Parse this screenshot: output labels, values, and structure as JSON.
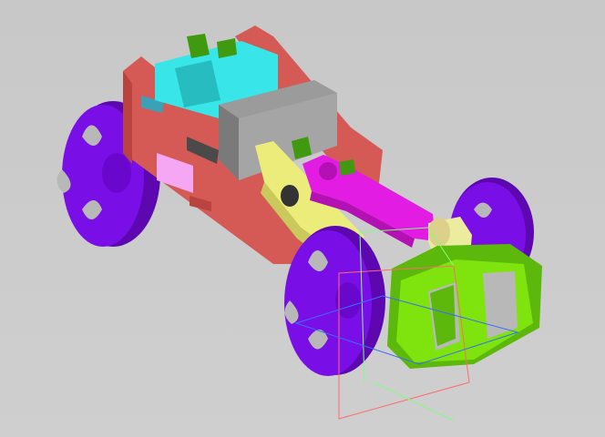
{
  "viewport": {
    "background": "#cbcbcb"
  },
  "model": {
    "parts": [
      {
        "name": "chassis-frame",
        "color": "#d55a55"
      },
      {
        "name": "motor-housing",
        "color": "#38e6ea"
      },
      {
        "name": "battery-block",
        "color": "#9b9b9b"
      },
      {
        "name": "wheel",
        "color": "#7a0ee6"
      },
      {
        "name": "crank-arm",
        "color": "#e31ce3"
      },
      {
        "name": "support-arm",
        "color": "#ecec7a"
      },
      {
        "name": "gear-cam",
        "color": "#7fe30e"
      },
      {
        "name": "axle-pin",
        "color": "#3f9a10"
      },
      {
        "name": "connector-plate",
        "color": "#f6a7f4"
      }
    ],
    "axes": {
      "x": "#ff6b6b",
      "y": "#7fff7f",
      "z": "#3a6cff"
    }
  }
}
